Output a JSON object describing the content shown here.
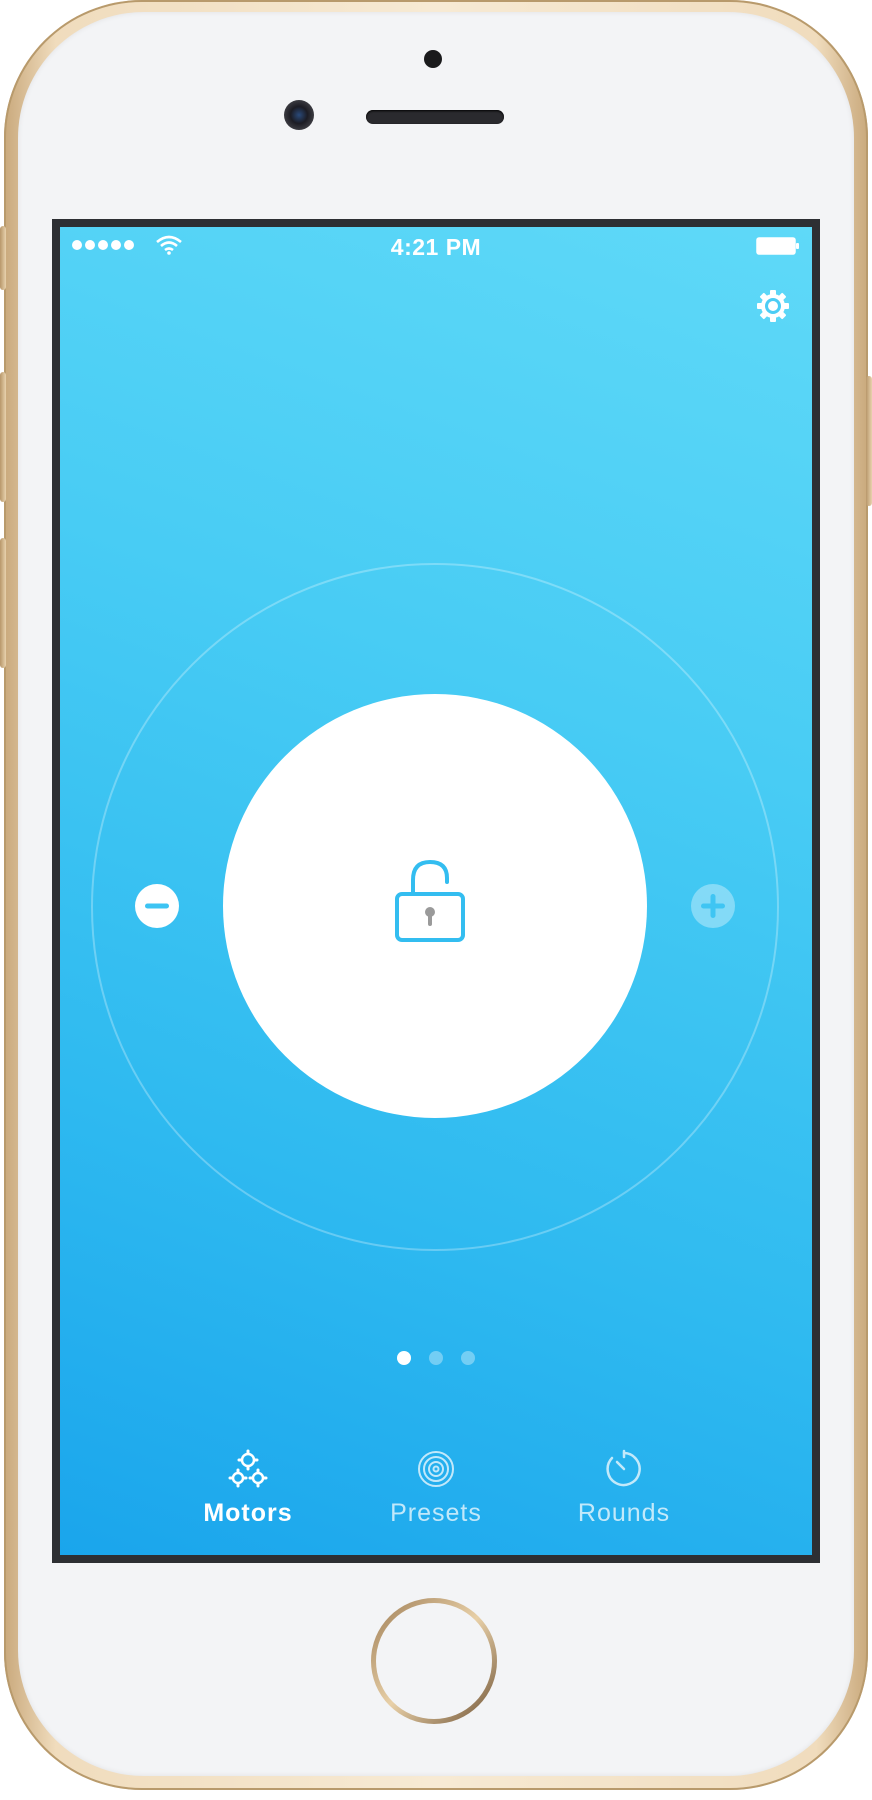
{
  "status_bar": {
    "time": "4:21 PM"
  },
  "settings": {
    "icon": "gear-icon"
  },
  "control": {
    "center_icon": "unlocked-padlock-icon",
    "decrease_icon": "minus-circle-icon",
    "increase_icon": "plus-circle-icon",
    "increase_enabled": false
  },
  "pager": {
    "page_count": 3,
    "current_page": 1
  },
  "tab_bar": {
    "tabs": [
      {
        "label": "Motors",
        "icon": "gears-icon",
        "active": true
      },
      {
        "label": "Presets",
        "icon": "concentric-circles-icon",
        "active": false
      },
      {
        "label": "Rounds",
        "icon": "timer-icon",
        "active": false
      }
    ]
  },
  "colors": {
    "gradient_top": "#5fd9f8",
    "gradient_bottom": "#1aa5ec",
    "accent": "#2fbaf0",
    "foreground": "#ffffff"
  }
}
